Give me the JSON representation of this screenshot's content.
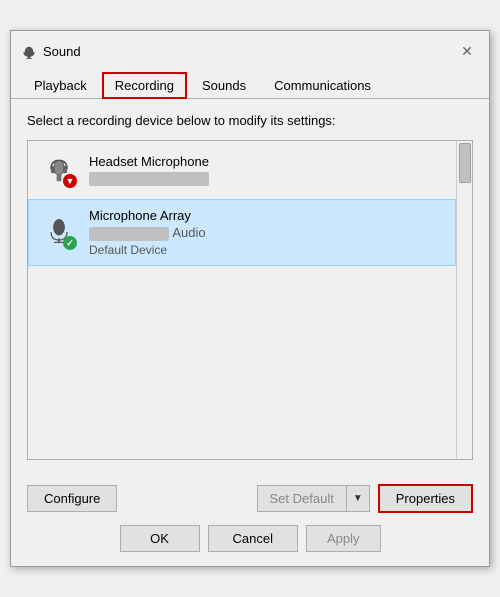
{
  "window": {
    "title": "Sound",
    "icon": "🔊",
    "close_label": "✕"
  },
  "tabs": [
    {
      "id": "playback",
      "label": "Playback",
      "active": false
    },
    {
      "id": "recording",
      "label": "Recording",
      "active": true
    },
    {
      "id": "sounds",
      "label": "Sounds",
      "active": false
    },
    {
      "id": "communications",
      "label": "Communications",
      "active": false
    }
  ],
  "instruction": "Select a recording device below to modify its settings:",
  "devices": [
    {
      "id": "headset-mic",
      "name": "Headset Microphone",
      "detail_redacted": true,
      "detail_width": 120,
      "status": "",
      "selected": false,
      "icon_type": "headset",
      "has_red_down": true
    },
    {
      "id": "mic-array",
      "name": "Microphone Array",
      "detail_suffix": "Audio",
      "detail_width": 80,
      "status": "Default Device",
      "selected": true,
      "icon_type": "microphone",
      "has_green_check": true
    }
  ],
  "buttons": {
    "configure": "Configure",
    "set_default": "Set Default",
    "properties": "Properties",
    "ok": "OK",
    "cancel": "Cancel",
    "apply": "Apply"
  }
}
